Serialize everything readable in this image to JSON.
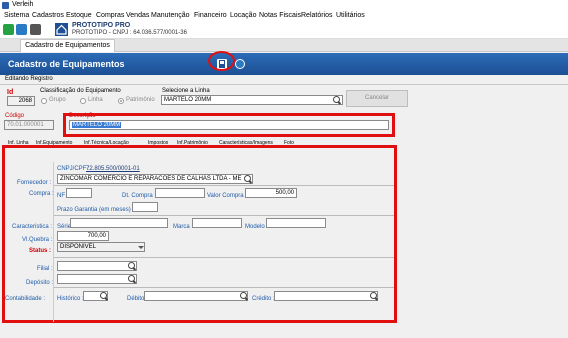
{
  "window": {
    "title": "Verleih"
  },
  "menu": [
    "Sistema",
    "Cadastros",
    "Estoque",
    "Compras",
    "Vendas",
    "Manutenção",
    "Financeiro",
    "Locação",
    "Notas Fiscais",
    "Relatórios",
    "Utilitários"
  ],
  "brand": {
    "name": "PROTOTIPO PRO",
    "sub": "PROTOTIPO - CNPJ : 64.036.577/0001-36"
  },
  "tab": "Cadastro de Equipamentos",
  "header": {
    "title": "Cadastro de Equipamentos"
  },
  "subtab": "Editando Registro",
  "form": {
    "id_label": "Id",
    "id_value": "2068",
    "class_label": "Classificação do Equipamento",
    "class_options": [
      "Grupo",
      "Linha",
      "Patrimônio"
    ],
    "linha_label": "Selecione a Linha",
    "linha_value": "MARTELO 20MM",
    "cancel_label": "Cancelar",
    "codigo_label": "Código",
    "codigo_value": "70.01.000001",
    "descricao_label": "Descrição",
    "descricao_value": "MARTELO 20MM"
  },
  "detail_tabs": [
    "Inf. Linha",
    "Inf.Equipamento",
    "Inf.Técnica/Locação",
    "Impostos",
    "Inf.Patrimônio",
    "Características/Imagens",
    "Foto"
  ],
  "patrimonio": {
    "fornecedor_label": "Fornecedor :",
    "cnpj_label": "CNPJ/CPF :",
    "cnpj_value": "72.805.500/0001-01",
    "fornecedor_value": "ZINCOMAR COMERCIO E REPARACOES DE CALHAS LTDA - ME",
    "compra_label": "Compra :",
    "nf_label": "NF :",
    "dt_compra_label": "Dt. Compra :",
    "valor_compra_label": "Valor Compra :",
    "valor_compra_value": "500,00",
    "prazo_label": "Prazo Garantia (em meses) :",
    "caracteristica_label": "Caracteristica :",
    "serie_label": "Série :",
    "marca_label": "Marca :",
    "modelo_label": "Modelo :",
    "vlquebra_label": "Vl.Quebra :",
    "vlquebra_value": "700,00",
    "status_label": "Status :",
    "status_value": "DISPONIVEL",
    "filial_label": "Filial :",
    "deposito_label": "Depósito :",
    "contabilidade_label": "Contabilidade :",
    "historico_label": "Histórico :",
    "debito_label": "Débito :",
    "credito_label": "Crédito :"
  }
}
